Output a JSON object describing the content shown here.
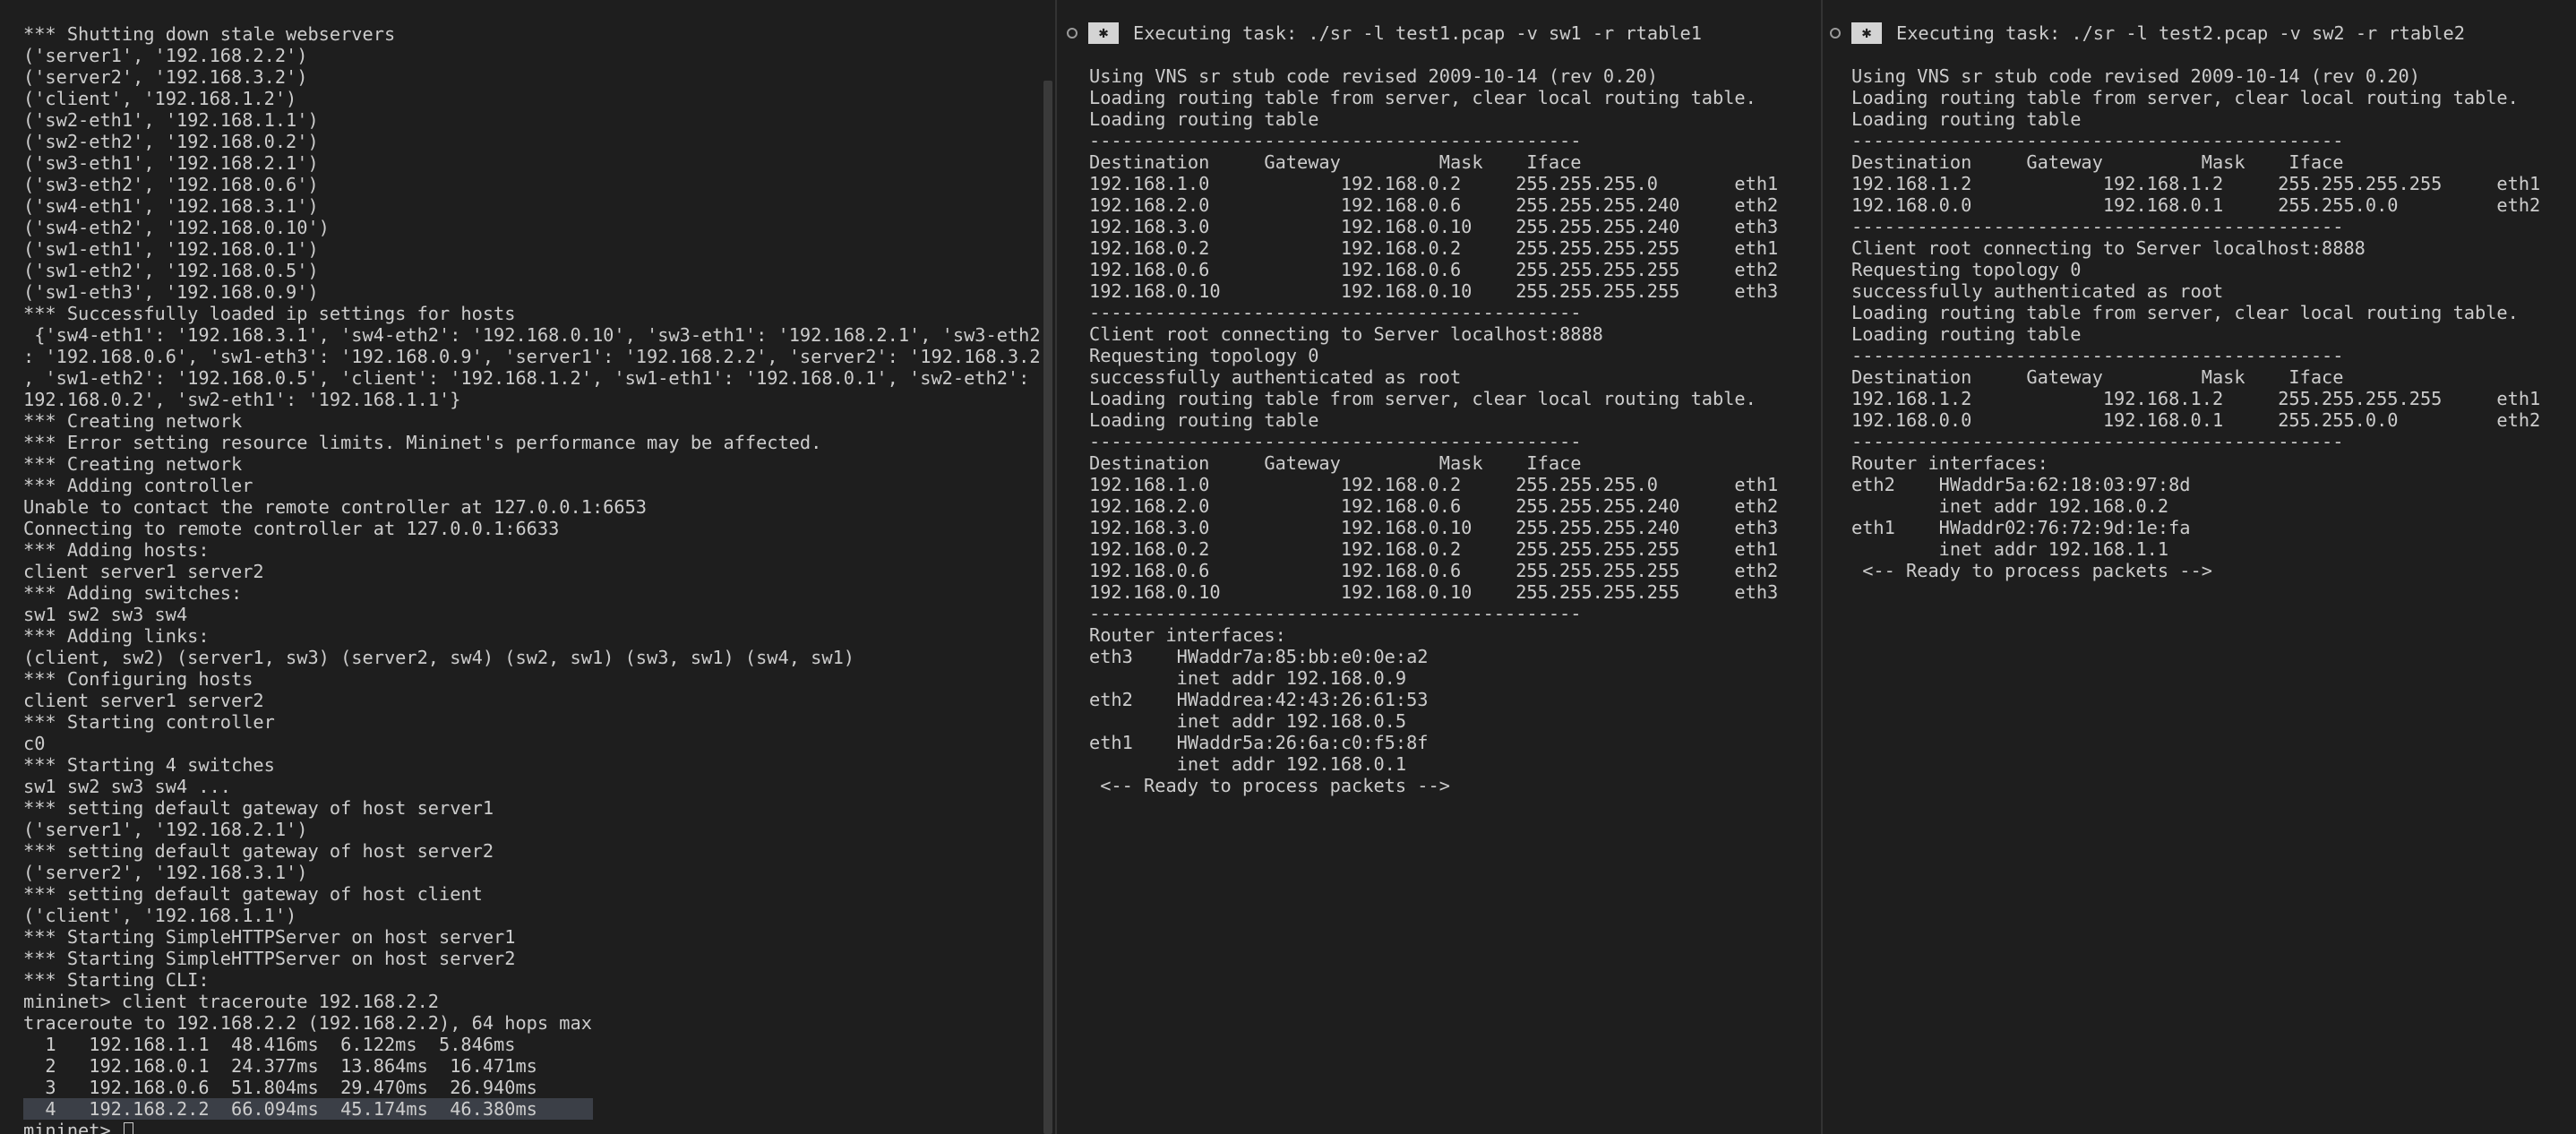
{
  "left_terminal": {
    "lines": [
      "*** Shutting down stale webservers",
      "('server1', '192.168.2.2')",
      "('server2', '192.168.3.2')",
      "('client', '192.168.1.2')",
      "('sw2-eth1', '192.168.1.1')",
      "('sw2-eth2', '192.168.0.2')",
      "('sw3-eth1', '192.168.2.1')",
      "('sw3-eth2', '192.168.0.6')",
      "('sw4-eth1', '192.168.3.1')",
      "('sw4-eth2', '192.168.0.10')",
      "('sw1-eth1', '192.168.0.1')",
      "('sw1-eth2', '192.168.0.5')",
      "('sw1-eth3', '192.168.0.9')",
      "*** Successfully loaded ip settings for hosts",
      " {'sw4-eth1': '192.168.3.1', 'sw4-eth2': '192.168.0.10', 'sw3-eth1': '192.168.2.1', 'sw3-eth2'",
      ": '192.168.0.6', 'sw1-eth3': '192.168.0.9', 'server1': '192.168.2.2', 'server2': '192.168.3.2'",
      ", 'sw1-eth2': '192.168.0.5', 'client': '192.168.1.2', 'sw1-eth1': '192.168.0.1', 'sw2-eth2': '",
      "192.168.0.2', 'sw2-eth1': '192.168.1.1'}",
      "*** Creating network",
      "*** Error setting resource limits. Mininet's performance may be affected.",
      "*** Creating network",
      "*** Adding controller",
      "Unable to contact the remote controller at 127.0.0.1:6653",
      "Connecting to remote controller at 127.0.0.1:6633",
      "*** Adding hosts:",
      "client server1 server2",
      "*** Adding switches:",
      "sw1 sw2 sw3 sw4",
      "*** Adding links:",
      "(client, sw2) (server1, sw3) (server2, sw4) (sw2, sw1) (sw3, sw1) (sw4, sw1)",
      "*** Configuring hosts",
      "client server1 server2",
      "*** Starting controller",
      "c0",
      "*** Starting 4 switches",
      "sw1 sw2 sw3 sw4 ...",
      "*** setting default gateway of host server1",
      "('server1', '192.168.2.1')",
      "*** setting default gateway of host server2",
      "('server2', '192.168.3.1')",
      "*** setting default gateway of host client",
      "('client', '192.168.1.1')",
      "*** Starting SimpleHTTPServer on host server1",
      "*** Starting SimpleHTTPServer on host server2",
      "*** Starting CLI:",
      "mininet> client traceroute 192.168.2.2",
      "traceroute to 192.168.2.2 (192.168.2.2), 64 hops max",
      "  1   192.168.1.1  48.416ms  6.122ms  5.846ms",
      "  2   192.168.0.1  24.377ms  13.864ms  16.471ms",
      "  3   192.168.0.6  51.804ms  29.470ms  26.940ms",
      "  4   192.168.2.2  66.094ms  45.174ms  46.380ms"
    ],
    "prompt": "mininet> "
  },
  "middle_terminal": {
    "title": "Executing task: ./sr -l test1.pcap -v sw1 -r rtable1",
    "lines": [
      "Using VNS sr stub code revised 2009-10-14 (rev 0.20)",
      "Loading routing table from server, clear local routing table.",
      "Loading routing table",
      "---------------------------------------------",
      "Destination     Gateway         Mask    Iface",
      "192.168.1.0            192.168.0.2     255.255.255.0       eth1",
      "192.168.2.0            192.168.0.6     255.255.255.240     eth2",
      "192.168.3.0            192.168.0.10    255.255.255.240     eth3",
      "192.168.0.2            192.168.0.2     255.255.255.255     eth1",
      "192.168.0.6            192.168.0.6     255.255.255.255     eth2",
      "192.168.0.10           192.168.0.10    255.255.255.255     eth3",
      "---------------------------------------------",
      "Client root connecting to Server localhost:8888",
      "Requesting topology 0",
      "successfully authenticated as root",
      "Loading routing table from server, clear local routing table.",
      "Loading routing table",
      "---------------------------------------------",
      "Destination     Gateway         Mask    Iface",
      "192.168.1.0            192.168.0.2     255.255.255.0       eth1",
      "192.168.2.0            192.168.0.6     255.255.255.240     eth2",
      "192.168.3.0            192.168.0.10    255.255.255.240     eth3",
      "192.168.0.2            192.168.0.2     255.255.255.255     eth1",
      "192.168.0.6            192.168.0.6     255.255.255.255     eth2",
      "192.168.0.10           192.168.0.10    255.255.255.255     eth3",
      "---------------------------------------------",
      "Router interfaces:",
      "eth3    HWaddr7a:85:bb:e0:0e:a2",
      "        inet addr 192.168.0.9",
      "eth2    HWaddrea:42:43:26:61:53",
      "        inet addr 192.168.0.5",
      "eth1    HWaddr5a:26:6a:c0:f5:8f",
      "        inet addr 192.168.0.1",
      " <-- Ready to process packets -->"
    ]
  },
  "right_terminal": {
    "title": "Executing task: ./sr -l test2.pcap -v sw2 -r rtable2",
    "lines": [
      "Using VNS sr stub code revised 2009-10-14 (rev 0.20)",
      "Loading routing table from server, clear local routing table.",
      "Loading routing table",
      "---------------------------------------------",
      "Destination     Gateway         Mask    Iface",
      "192.168.1.2            192.168.1.2     255.255.255.255     eth1",
      "192.168.0.0            192.168.0.1     255.255.0.0         eth2",
      "---------------------------------------------",
      "Client root connecting to Server localhost:8888",
      "Requesting topology 0",
      "successfully authenticated as root",
      "Loading routing table from server, clear local routing table.",
      "Loading routing table",
      "---------------------------------------------",
      "Destination     Gateway         Mask    Iface",
      "192.168.1.2            192.168.1.2     255.255.255.255     eth1",
      "192.168.0.0            192.168.0.1     255.255.0.0         eth2",
      "---------------------------------------------",
      "Router interfaces:",
      "eth2    HWaddr5a:62:18:03:97:8d",
      "        inet addr 192.168.0.2",
      "eth1    HWaddr02:76:72:9d:1e:fa",
      "        inet addr 192.168.1.1",
      " <-- Ready to process packets -->"
    ]
  }
}
